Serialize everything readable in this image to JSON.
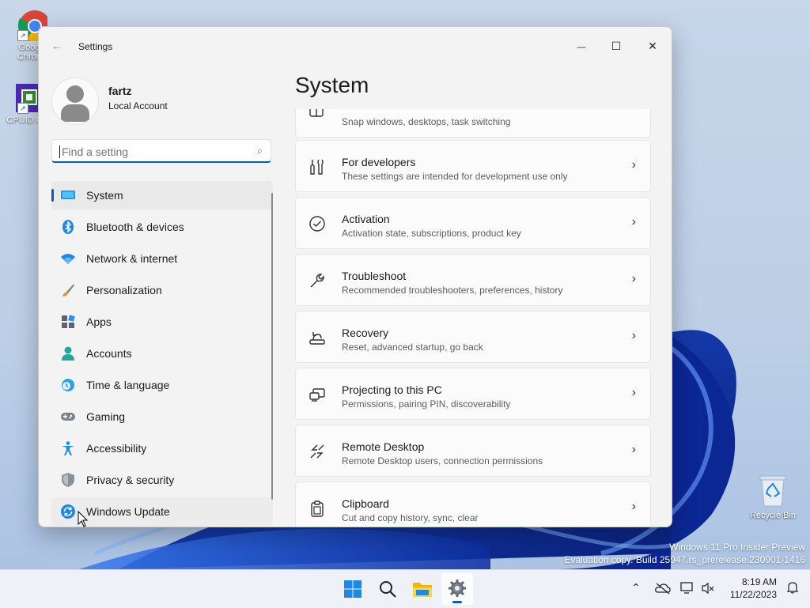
{
  "desktop": {
    "icons": [
      {
        "label": "Goog Chron",
        "line1": "Goog",
        "line2": "Chron"
      },
      {
        "label": "CPUID C",
        "line1": "CPUID C"
      }
    ],
    "recycle_bin_label": "Recycle Bin",
    "watermark": {
      "line1": "Windows 11 Pro Insider Preview",
      "line2": "Evaluation copy. Build 25947.rs_prerelease.230901-1416"
    }
  },
  "window": {
    "app_title": "Settings",
    "controls": {
      "minimize": "—",
      "maximize": "☐",
      "close": "✕"
    },
    "back_icon": "arrow-left-icon"
  },
  "profile": {
    "name": "fartz",
    "account_type": "Local Account"
  },
  "search": {
    "placeholder": "Find a setting",
    "value": ""
  },
  "nav": {
    "items": [
      {
        "label": "System",
        "icon": "monitor-icon",
        "selected": true
      },
      {
        "label": "Bluetooth & devices",
        "icon": "bluetooth-icon"
      },
      {
        "label": "Network & internet",
        "icon": "wifi-icon"
      },
      {
        "label": "Personalization",
        "icon": "brush-icon"
      },
      {
        "label": "Apps",
        "icon": "apps-icon"
      },
      {
        "label": "Accounts",
        "icon": "person-icon"
      },
      {
        "label": "Time & language",
        "icon": "globe-clock-icon"
      },
      {
        "label": "Gaming",
        "icon": "gamepad-icon"
      },
      {
        "label": "Accessibility",
        "icon": "accessibility-icon"
      },
      {
        "label": "Privacy & security",
        "icon": "shield-icon"
      },
      {
        "label": "Windows Update",
        "icon": "update-icon"
      }
    ]
  },
  "page": {
    "title": "System",
    "cards": [
      {
        "title": "",
        "subtitle": "Snap windows, desktops, task switching",
        "icon": "multitasking-icon"
      },
      {
        "title": "For developers",
        "subtitle": "These settings are intended for development use only",
        "icon": "developer-tools-icon"
      },
      {
        "title": "Activation",
        "subtitle": "Activation state, subscriptions, product key",
        "icon": "activation-check-icon"
      },
      {
        "title": "Troubleshoot",
        "subtitle": "Recommended troubleshooters, preferences, history",
        "icon": "wrench-icon"
      },
      {
        "title": "Recovery",
        "subtitle": "Reset, advanced startup, go back",
        "icon": "recovery-icon"
      },
      {
        "title": "Projecting to this PC",
        "subtitle": "Permissions, pairing PIN, discoverability",
        "icon": "projecting-icon"
      },
      {
        "title": "Remote Desktop",
        "subtitle": "Remote Desktop users, connection permissions",
        "icon": "remote-desktop-icon"
      },
      {
        "title": "Clipboard",
        "subtitle": "Cut and copy history, sync, clear",
        "icon": "clipboard-icon"
      }
    ]
  },
  "taskbar": {
    "apps": [
      "start-icon",
      "search-icon",
      "file-explorer-icon",
      "settings-icon"
    ],
    "active_app": "settings-icon",
    "tray": [
      "chevron-up-icon",
      "onedrive-icon",
      "network-icon",
      "volume-muted-icon"
    ],
    "time": "8:19 AM",
    "date": "11/22/2023",
    "notification_icon": "bell-icon"
  },
  "colors": {
    "accent": "#005fb8",
    "window_bg": "#f3f3f3",
    "card_bg": "#fbfbfb"
  }
}
